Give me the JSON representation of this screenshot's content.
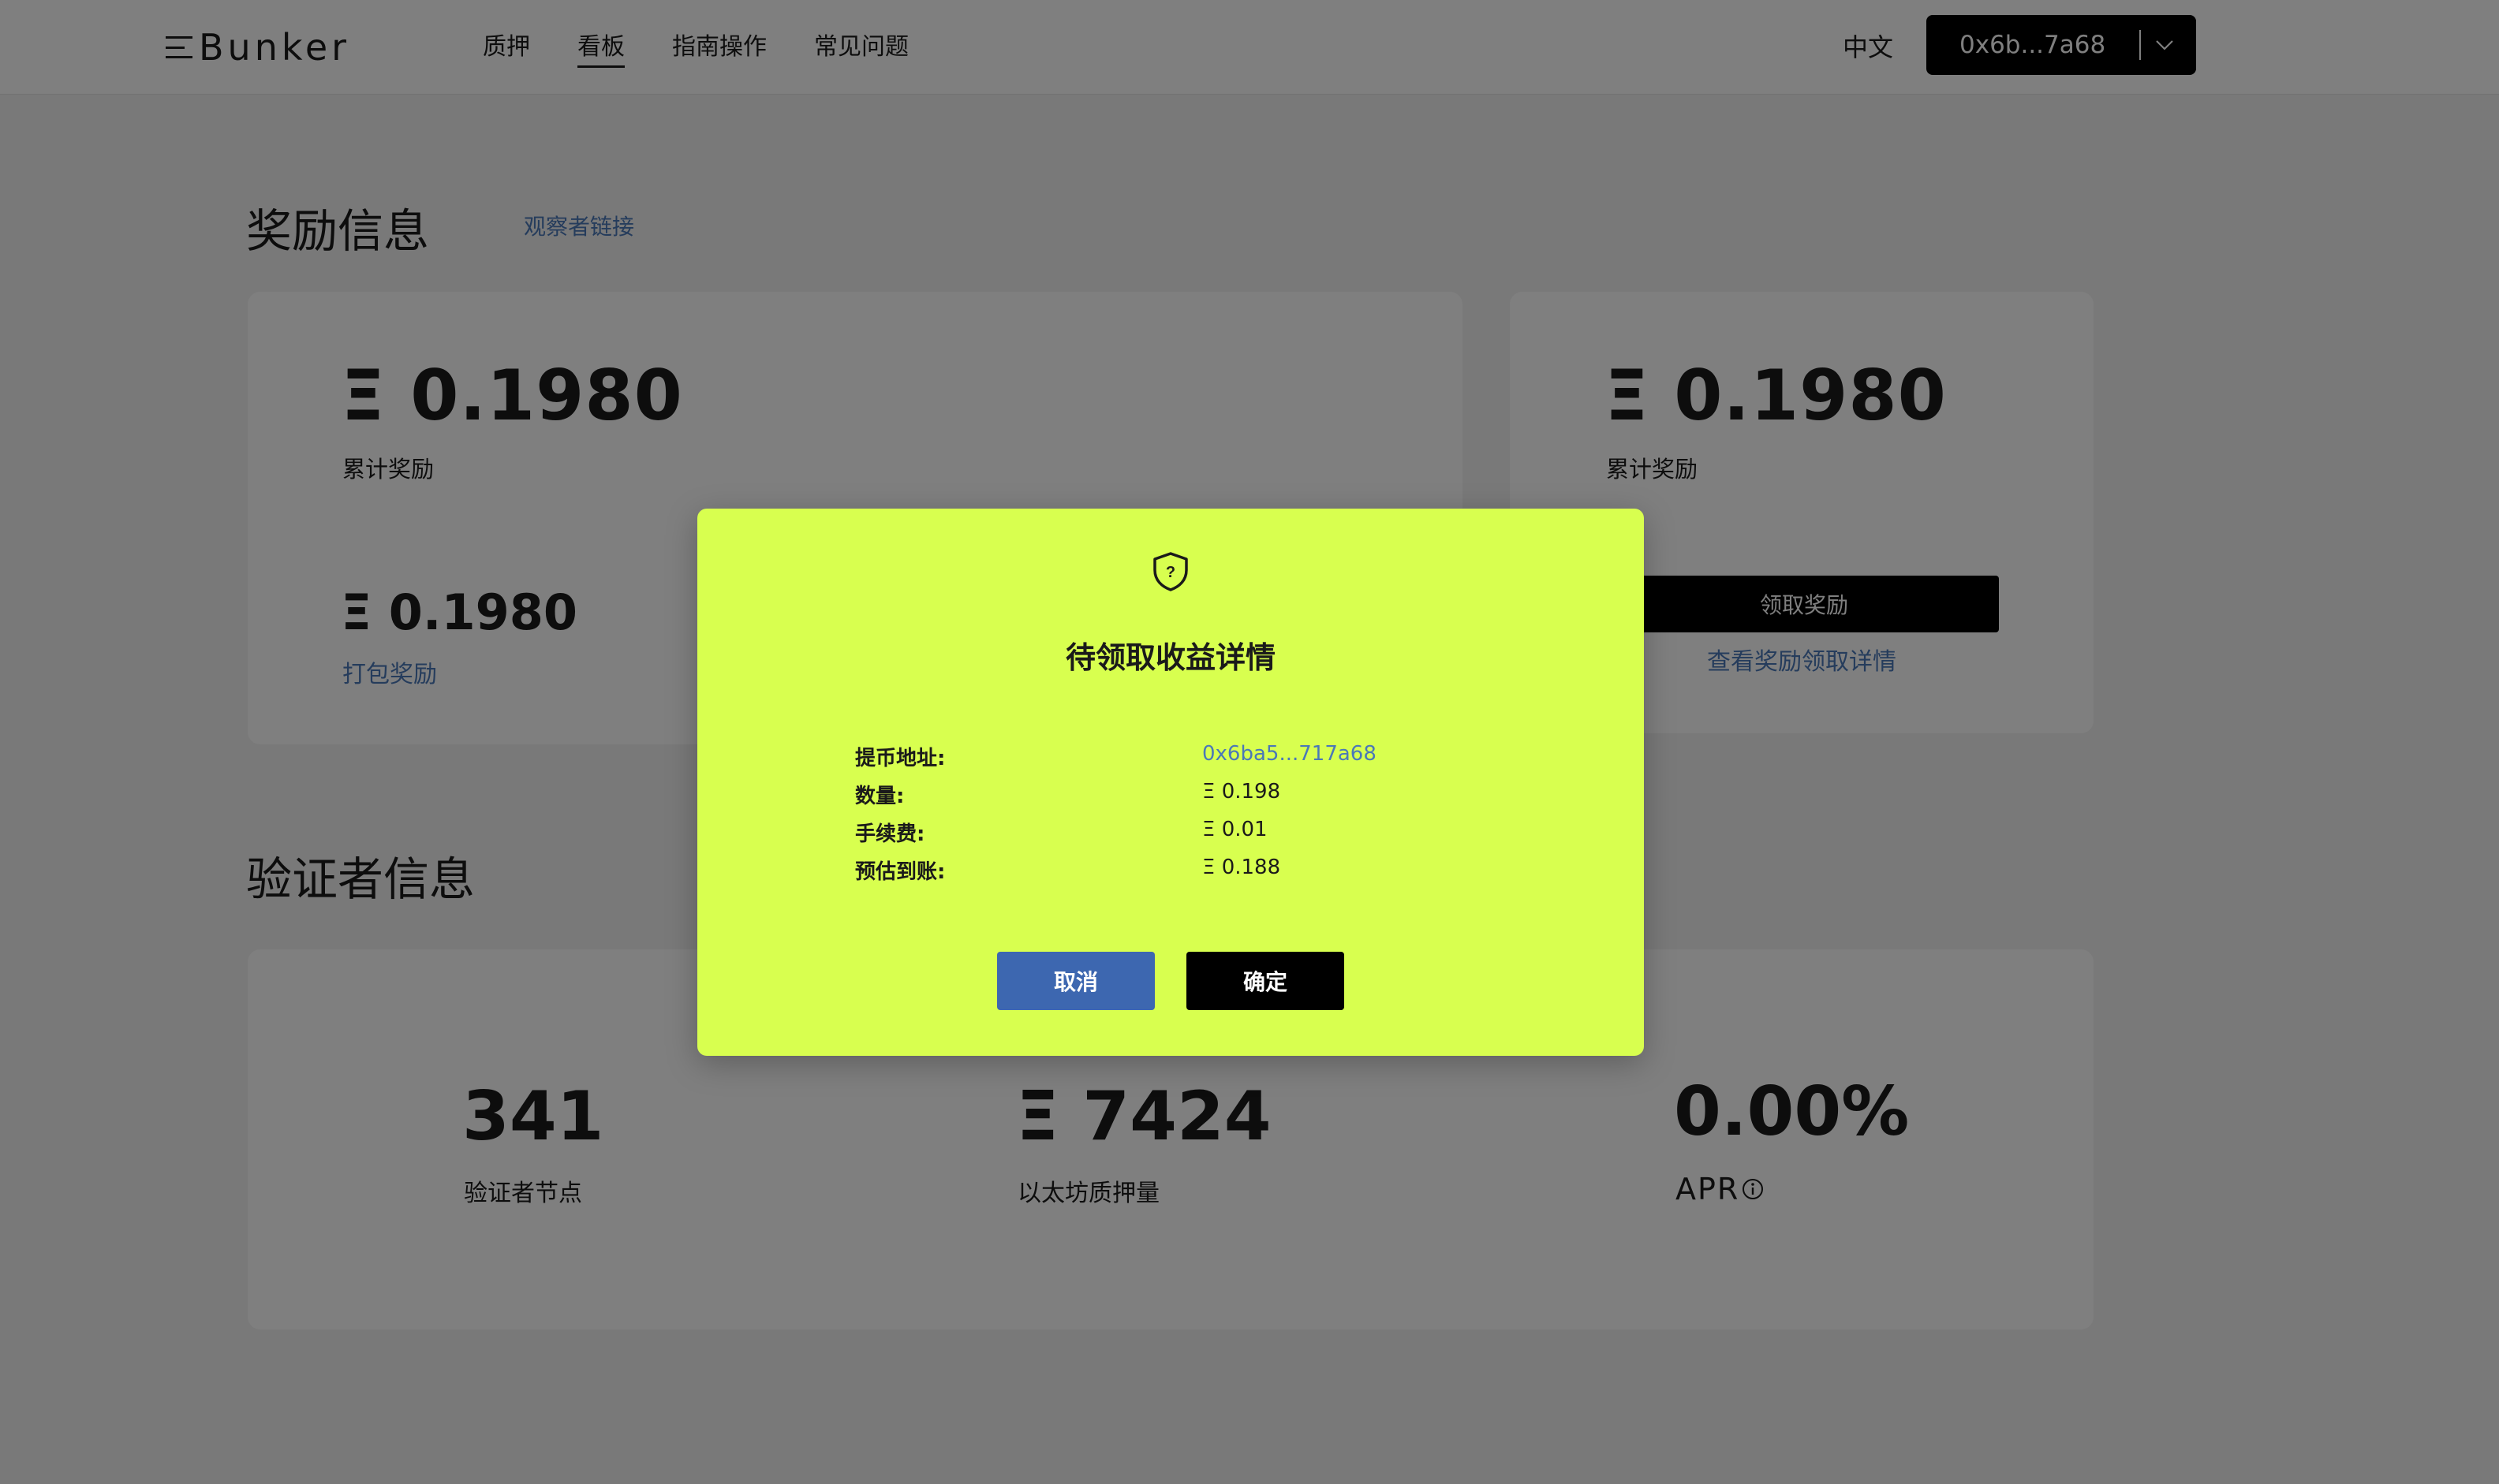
{
  "header": {
    "logo_text": "Bunker",
    "nav": [
      {
        "label": "质押",
        "active": false
      },
      {
        "label": "看板",
        "active": true
      },
      {
        "label": "指南操作",
        "active": false
      },
      {
        "label": "常见问题",
        "active": false
      }
    ],
    "language": "中文",
    "wallet_address": "0x6b...7a68"
  },
  "rewards": {
    "section_title": "奖励信息",
    "observer_link": "观察者链接",
    "left_card": {
      "total_value": "Ξ 0.1980",
      "total_label": "累计奖励",
      "bundle_value": "Ξ 0.1980",
      "bundle_label": "打包奖励"
    },
    "right_card": {
      "total_value": "Ξ 0.1980",
      "total_label": "累计奖励",
      "claim_button": "领取奖励",
      "details_link": "查看奖励领取详情"
    }
  },
  "validators": {
    "section_title": "验证者信息",
    "stats": [
      {
        "value": "341",
        "label": "验证者节点"
      },
      {
        "value": "Ξ 7424",
        "label": "以太坊质押量"
      },
      {
        "value": "0.00%",
        "label": "APR"
      }
    ]
  },
  "modal": {
    "title": "待领取收益详情",
    "rows": [
      {
        "label": "提币地址:",
        "value": "0x6ba5...717a68"
      },
      {
        "label": "数量:",
        "value": "Ξ 0.198"
      },
      {
        "label": "手续费:",
        "value": "Ξ 0.01"
      },
      {
        "label": "预估到账:",
        "value": "Ξ 0.188"
      }
    ],
    "cancel_label": "取消",
    "confirm_label": "确定"
  }
}
